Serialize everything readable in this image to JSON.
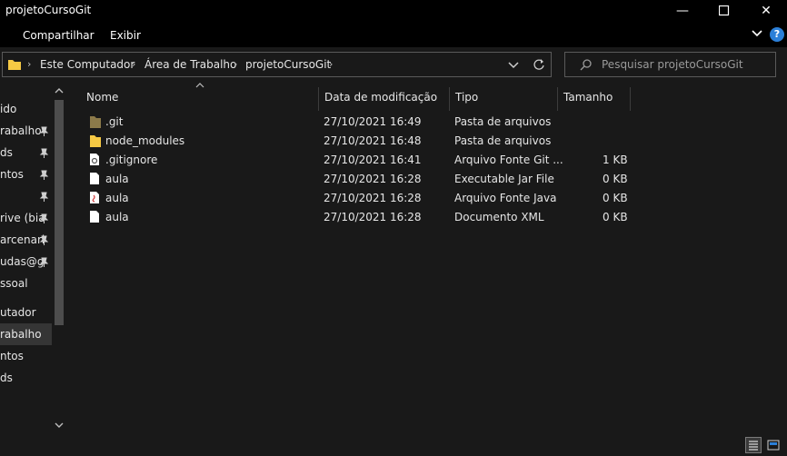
{
  "window": {
    "title": "projetoCursoGit"
  },
  "ribbon": {
    "tabs": [
      "Compartilhar",
      "Exibir"
    ],
    "help": "?"
  },
  "address": {
    "crumbs": [
      "Este Computador",
      "Área de Trabalho",
      "projetoCursoGit"
    ]
  },
  "search": {
    "placeholder": "Pesquisar projetoCursoGit"
  },
  "nav": {
    "items": [
      {
        "label": "ido",
        "pinned": false
      },
      {
        "label": "rabalho",
        "pinned": true
      },
      {
        "label": "ds",
        "pinned": true
      },
      {
        "label": "ntos",
        "pinned": true
      },
      {
        "label": "",
        "pinned": true
      },
      {
        "label": "rive (bia",
        "pinned": true
      },
      {
        "label": "arcenari",
        "pinned": true
      },
      {
        "label": "udas@g",
        "pinned": true
      },
      {
        "label": "ssoal",
        "pinned": false
      },
      {
        "label": "utador",
        "pinned": false
      },
      {
        "label": "rabalho",
        "pinned": false,
        "active": true
      },
      {
        "label": "ntos",
        "pinned": false
      },
      {
        "label": "ds",
        "pinned": false
      }
    ]
  },
  "columns": [
    "Nome",
    "Data de modificação",
    "Tipo",
    "Tamanho"
  ],
  "files": [
    {
      "name": ".git",
      "date": "27/10/2021 16:49",
      "type": "Pasta de arquivos",
      "size": "",
      "icon": "git-folder-icon"
    },
    {
      "name": "node_modules",
      "date": "27/10/2021 16:48",
      "type": "Pasta de arquivos",
      "size": "",
      "icon": "folder-icon"
    },
    {
      "name": ".gitignore",
      "date": "27/10/2021 16:41",
      "type": "Arquivo Fonte Git ...",
      "size": "1 KB",
      "icon": "git-file-icon"
    },
    {
      "name": "aula",
      "date": "27/10/2021 16:28",
      "type": "Executable Jar File",
      "size": "0 KB",
      "icon": "file-icon"
    },
    {
      "name": "aula",
      "date": "27/10/2021 16:28",
      "type": "Arquivo Fonte Java",
      "size": "0 KB",
      "icon": "java-file-icon"
    },
    {
      "name": "aula",
      "date": "27/10/2021 16:28",
      "type": "Documento XML",
      "size": "0 KB",
      "icon": "xml-file-icon"
    }
  ],
  "colors": {
    "folder": "#f6c944",
    "git_folder": "#8c7a4a",
    "accent": "#2b7fd8"
  }
}
